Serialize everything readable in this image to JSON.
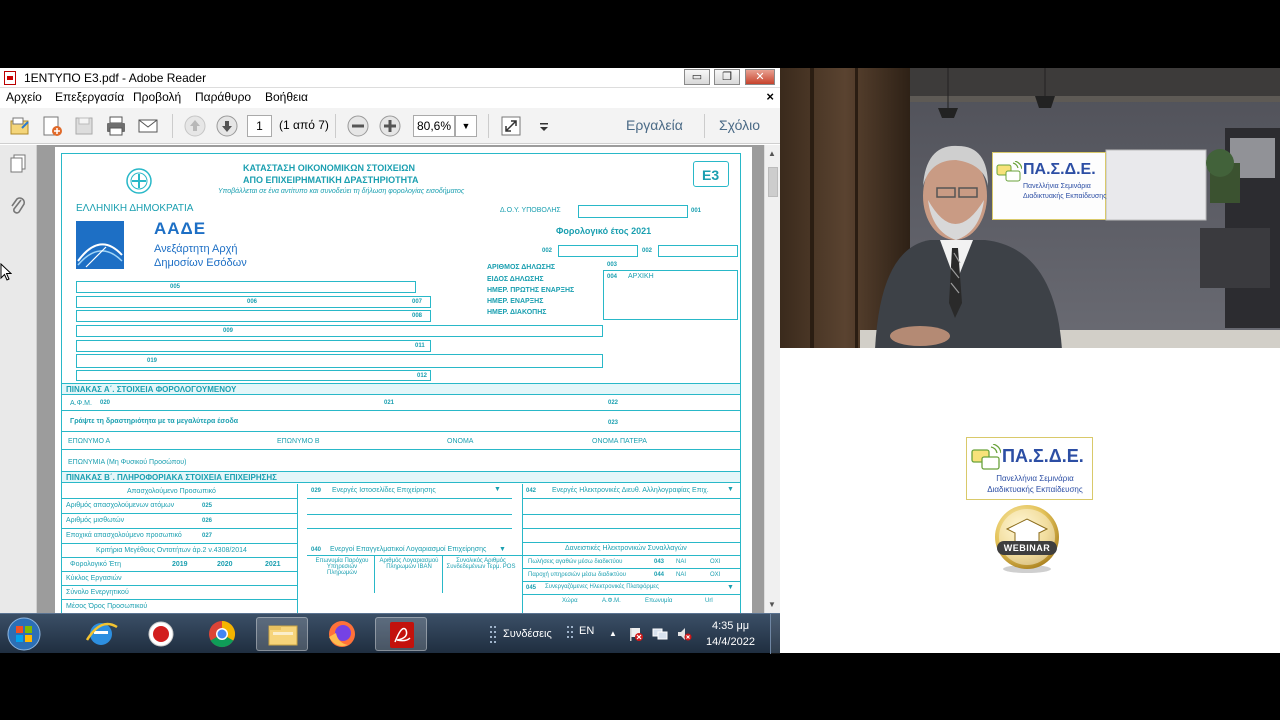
{
  "reader": {
    "window_title": "1ΕΝΤΥΠΟ Ε3.pdf - Adobe Reader",
    "window_buttons": {
      "minimize": "▭",
      "restore": "❐",
      "close": "✕"
    },
    "menu": [
      "Αρχείο",
      "Επεξεργασία",
      "Προβολή",
      "Παράθυρο",
      "Βοήθεια"
    ],
    "menu_close": "×",
    "toolbar": {
      "page_number": "1",
      "page_of": "(1 από 7)",
      "zoom": "80,6%",
      "tools_label": "Εργαλεία",
      "comment_label": "Σχόλιο"
    }
  },
  "form": {
    "title_line1": "ΚΑΤΑΣΤΑΣΗ ΟΙΚΟΝΟΜΙΚΩΝ ΣΤΟΙΧΕΙΩΝ",
    "title_line2": "ΑΠΟ ΕΠΙΧΕΙΡΗΜΑΤΙΚΗ ΔΡΑΣΤΗΡΙΟΤΗΤΑ",
    "subtitle": "Υποβάλλεται σε ένα αντίτυπο και συνοδεύει τη δήλωση φορολογίας εισοδήματος",
    "form_code": "Ε3",
    "republic": "ΕΛΛΗΝΙΚΗ ΔΗΜΟΚΡΑΤΙΑ",
    "aade": "ΑΑΔΕ",
    "aade_line1": "Ανεξάρτητη Αρχή",
    "aade_line2": "Δημοσίων Εσόδων",
    "doy": "Δ.Ο.Υ. ΥΠΟΒΟΛΗΣ",
    "tax_year": "Φορολογικό έτος 2021",
    "decl_no": "ΑΡΙΘΜΟΣ ΔΗΛΩΣΗΣ",
    "decl_type": "ΕΙΔΟΣ ΔΗΛΩΣΗΣ",
    "first_start": "ΗΜΕΡ. ΠΡΩΤΗΣ ΕΝΑΡΞΗΣ",
    "start": "ΗΜΕΡ. ΕΝΑΡΞΗΣ",
    "end": "ΗΜΕΡ. ΔΙΑΚΟΠΗΣ",
    "initial": "ΑΡΧΙΚΗ",
    "table_a": "ΠΙΝΑΚΑΣ Α΄. ΣΤΟΙΧΕΙΑ ΦΟΡΟΛΟΓΟΥΜΕΝΟΥ",
    "afm": "Α.Φ.Μ.",
    "activity_hint": "Γράψτε τη δραστηριότητα με τα μεγαλύτερα έσοδα",
    "surname_a": "ΕΠΩΝΥΜΟ Α",
    "surname_b": "ΕΠΩΝΥΜΟ Β",
    "name": "ΟΝΟΜΑ",
    "father": "ΟΝΟΜΑ ΠΑΤΕΡΑ",
    "company": "ΕΠΩΝΥΜΙΑ (Μη Φυσικού Προσώπου)",
    "table_b": "ΠΙΝΑΚΑΣ Β΄. ΠΛΗΡΟΦΟΡΙΑΚΑ ΣΤΟΙΧΕΙΑ ΕΠΙΧΕΙΡΗΣΗΣ",
    "staff": "Απασχολούμενο Προσωπικό",
    "staff_rows": [
      "Αριθμός απασχολούμενων ατόμων",
      "Αριθμός μισθωτών",
      "Εποχικά απασχολούμενο προσωπικό"
    ],
    "staff_codes": [
      "025",
      "026",
      "027"
    ],
    "size_criteria": "Κριτήρια Μεγέθους Οντοτήτων άρ.2 ν.4308/2014",
    "fiscal_year": "Φορολογικό Έτη",
    "years": [
      "2019",
      "2020",
      "2021"
    ],
    "size_rows": [
      "Κύκλος Εργασιών",
      "Σύνολο Ενεργητικού",
      "Μέσος Όρος Προσωπικού"
    ],
    "websites": "Ενεργές Ιστοσελίδες Επιχείρησης",
    "einvoice": "Ενεργές Ηλεκτρονικές Διευθ. Αλληλογραφίας Επιχ.",
    "pos": "Ενεργοί Επαγγελματικοί Λογαριασμοί Επιχείρησης",
    "payments": "Δανειστικές Ηλεκτρονικών Συναλλαγών",
    "pos_cols": [
      "Επωνυμία Παρόχου Υπηρεσιών Πληρωμών",
      "Αριθμός Λογαριασμού Πληρωμών ΙΒΑΝ",
      "Συνολικός Αριθμός Συνδεδεμένων Τερμ. POS"
    ],
    "platforms": "Συνεργαζόμενες Ηλεκτρονικές Πλατφόρμες",
    "platform_cols": [
      "Χώρα",
      "Α.Φ.Μ.",
      "Επωνυμία",
      "Url"
    ],
    "payment_rows": [
      "Πωλήσεις αγαθών μέσω διαδικτύου",
      "Παροχή υπηρεσιών μέσω διαδικτύου"
    ],
    "codes": {
      "doy": "001",
      "year": "002",
      "decl": "003",
      "type": "004",
      "c005": "005",
      "c006": "006",
      "c007": "007",
      "c008": "008",
      "c009": "009",
      "c011": "011",
      "c012": "012",
      "c019": "019",
      "afm": "020",
      "c021": "021",
      "c022": "022",
      "c023": "023",
      "c029": "029",
      "c040": "040",
      "c042": "042",
      "c043": "043",
      "c044": "044",
      "c045": "045"
    },
    "na": "ΝΑΙ",
    "oxi": "ΟΧΙ"
  },
  "taskbar": {
    "connections": "Συνδέσεις",
    "language": "EN",
    "time": "4:35 μμ",
    "date": "14/4/2022"
  },
  "branding": {
    "pasde": "ΠΑ.Σ.Δ.Ε.",
    "sub1": "Πανελλήνια Σεμινάρια",
    "sub2": "Διαδικτυακής Εκπαίδευσης",
    "webinar": "WEBINAR"
  },
  "colors": {
    "form_cyan": "#29b8c8",
    "reader_link": "#4a6a86",
    "brand_blue": "#2c4ea4",
    "taskbar": "#2a3b52"
  }
}
